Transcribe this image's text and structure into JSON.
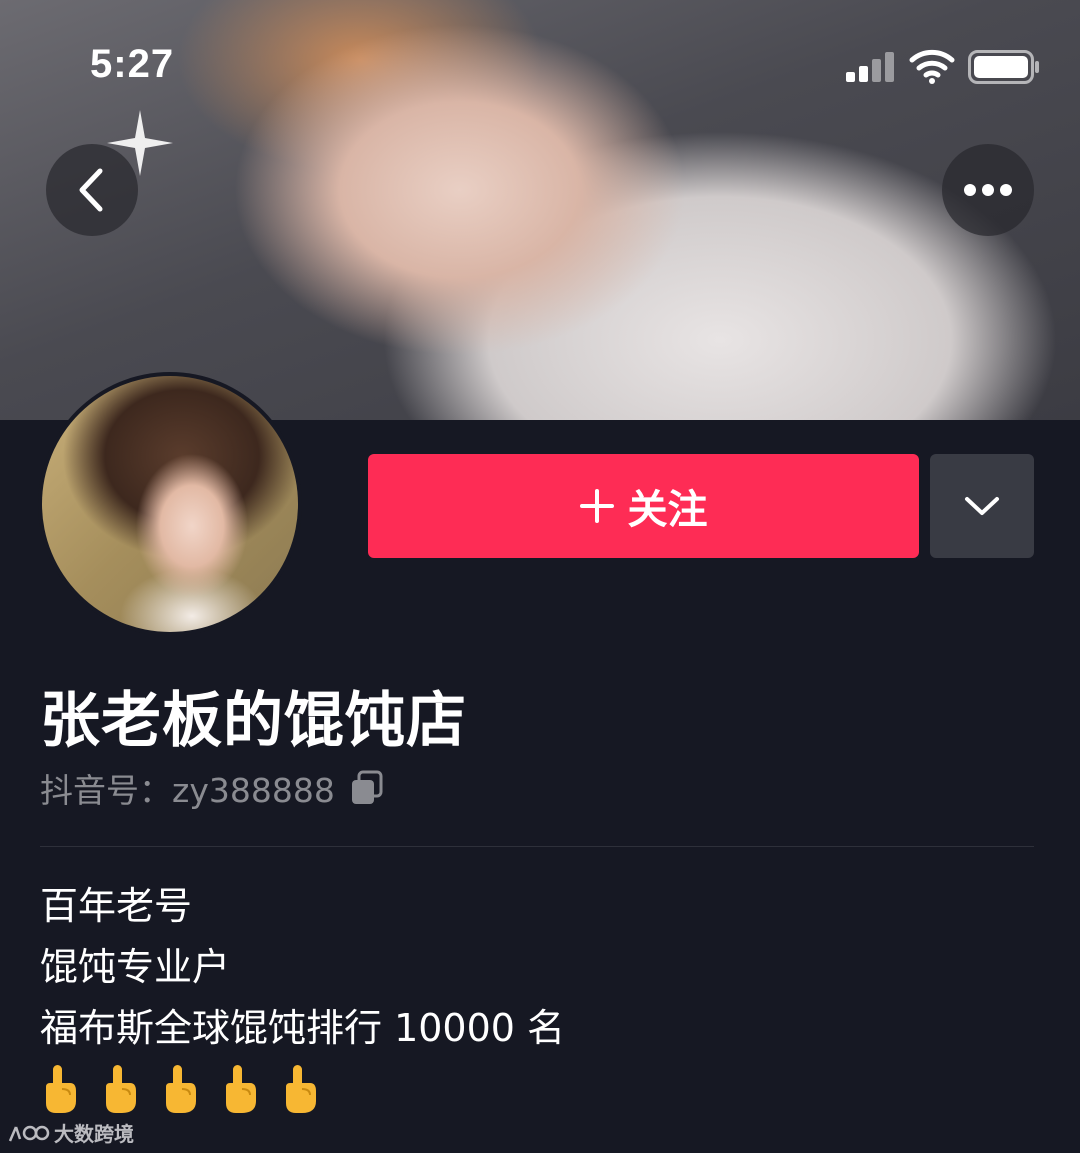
{
  "status_bar": {
    "time": "5:27",
    "signal_icon": "cellular-signal-icon",
    "wifi_icon": "wifi-icon",
    "battery_icon": "battery-icon"
  },
  "header": {
    "back_icon": "chevron-left-icon",
    "more_icon": "ellipsis-icon"
  },
  "profile": {
    "follow_label": "关注",
    "nickname": "张老板的馄饨店",
    "douyin_id_label": "抖音号：",
    "douyin_id": "zy388888",
    "bio_lines": [
      "百年老号",
      "馄饨专业户",
      "福布斯全球馄饨排行 10000 名"
    ],
    "bio_emoji_count": 5
  },
  "watermark": {
    "text": "大数跨境"
  },
  "colors": {
    "background": "#161823",
    "accent": "#fe2c55",
    "secondary_button": "#393b44",
    "muted_text": "#8a8b91"
  }
}
